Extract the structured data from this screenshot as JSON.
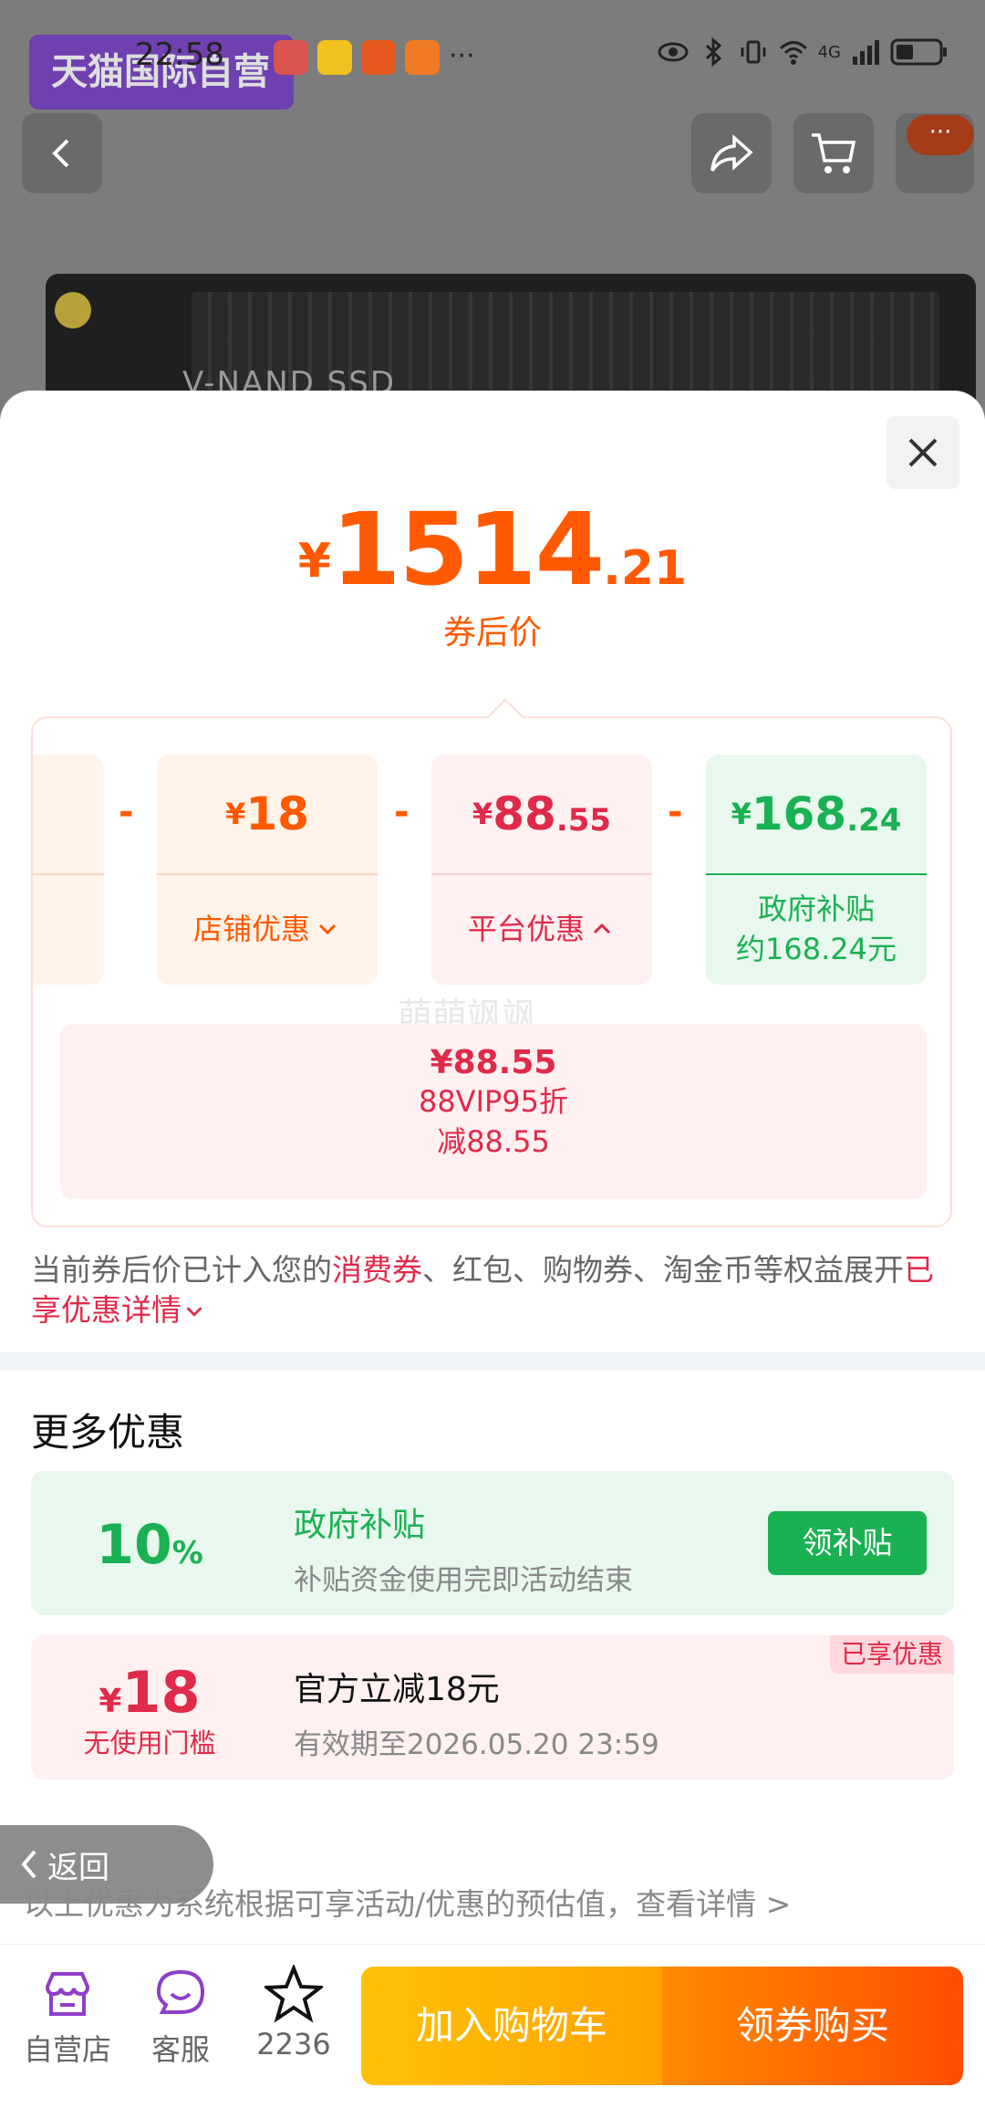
{
  "status_bar": {
    "time": "22:58",
    "overflow": "···",
    "network": "4G"
  },
  "header": {
    "store_badge": "天猫国际自营",
    "product_label": "V-NAND SSD"
  },
  "sheet": {
    "price": {
      "currency": "¥",
      "integer": "1514",
      "decimal": ".21",
      "label": "券后价"
    },
    "breakdown": {
      "cards": [
        {
          "amount_currency": "¥",
          "amount_int": "18",
          "amount_dec": "",
          "label": "店铺优惠",
          "chevron": "⌄"
        },
        {
          "amount_currency": "¥",
          "amount_int": "88",
          "amount_dec": ".55",
          "label": "平台优惠",
          "chevron": "⌃"
        },
        {
          "amount_currency": "¥",
          "amount_int": "168",
          "amount_dec": ".24",
          "label_line1": "政府补贴",
          "label_line2": "约168.24元"
        }
      ],
      "minus": "-",
      "detail": {
        "value": "¥88.55",
        "line1": "88VIP95折",
        "line2": "减88.55"
      },
      "watermark": "萌萌飒飒"
    },
    "note": {
      "prefix": "当前券后价已计入您的",
      "highlight": "消费券",
      "suffix": "、红包、购物券、淘金币等权益展开",
      "link": "已享优惠详情"
    },
    "more_title": "更多优惠",
    "back_label": "返回",
    "promos": [
      {
        "big": "10",
        "big_unit": "%",
        "title": "政府补贴",
        "sub": "补贴资金使用完即活动结束",
        "action": "领补贴"
      },
      {
        "big_currency": "¥",
        "big": "18",
        "big_sub": "无使用门槛",
        "title": "官方立减18元",
        "sub": "有效期至2026.05.20 23:59",
        "tag": "已享优惠"
      }
    ],
    "footnote": "以上优惠为系统根据可享活动/优惠的预估值，查看详情 >"
  },
  "bottom_bar": {
    "store": "自营店",
    "service": "客服",
    "favorites": "2236",
    "add_to_cart": "加入购物车",
    "buy": "领券购买"
  },
  "colors": {
    "accent": "#ff5a00",
    "red": "#e02a4a",
    "green": "#1ab152"
  }
}
